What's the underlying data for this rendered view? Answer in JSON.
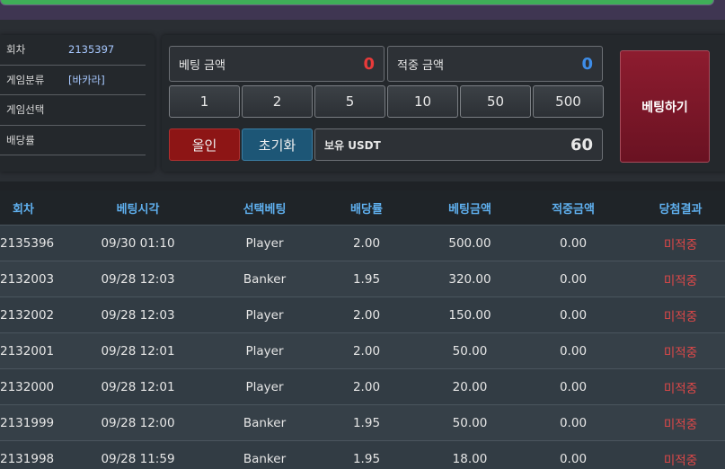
{
  "info": {
    "rows": [
      {
        "label": "회차",
        "value": "2135397"
      },
      {
        "label": "게임분류",
        "value": "[바카라]"
      },
      {
        "label": "게임선택",
        "value": ""
      },
      {
        "label": "배당률",
        "value": ""
      }
    ]
  },
  "bet": {
    "bet_amount_label": "베팅 금액",
    "bet_amount_value": "0",
    "win_amount_label": "적중 금액",
    "win_amount_value": "0",
    "chips": [
      "1",
      "2",
      "5",
      "10",
      "50",
      "500"
    ],
    "allin_label": "올인",
    "reset_label": "초기화",
    "usdt_label": "보유 USDT",
    "usdt_value": "60",
    "bet_button_label": "베팅하기"
  },
  "colors": {
    "bet_red": "#e83a3a",
    "win_blue": "#3e8de8",
    "header_blue": "#5fb0ef",
    "result_red": "#e04848"
  },
  "table": {
    "headers": [
      "회차",
      "베팅시각",
      "선택베팅",
      "배당률",
      "베팅금액",
      "적중금액",
      "당첨결과"
    ],
    "rows": [
      [
        "2135396",
        "09/30 01:10",
        "Player",
        "2.00",
        "500.00",
        "0.00",
        "미적중"
      ],
      [
        "2132003",
        "09/28 12:03",
        "Banker",
        "1.95",
        "320.00",
        "0.00",
        "미적중"
      ],
      [
        "2132002",
        "09/28 12:03",
        "Player",
        "2.00",
        "150.00",
        "0.00",
        "미적중"
      ],
      [
        "2132001",
        "09/28 12:01",
        "Player",
        "2.00",
        "50.00",
        "0.00",
        "미적중"
      ],
      [
        "2132000",
        "09/28 12:01",
        "Player",
        "2.00",
        "20.00",
        "0.00",
        "미적중"
      ],
      [
        "2131999",
        "09/28 12:00",
        "Banker",
        "1.95",
        "50.00",
        "0.00",
        "미적중"
      ],
      [
        "2131998",
        "09/28 11:59",
        "Banker",
        "1.95",
        "18.00",
        "0.00",
        "미적중"
      ]
    ]
  }
}
